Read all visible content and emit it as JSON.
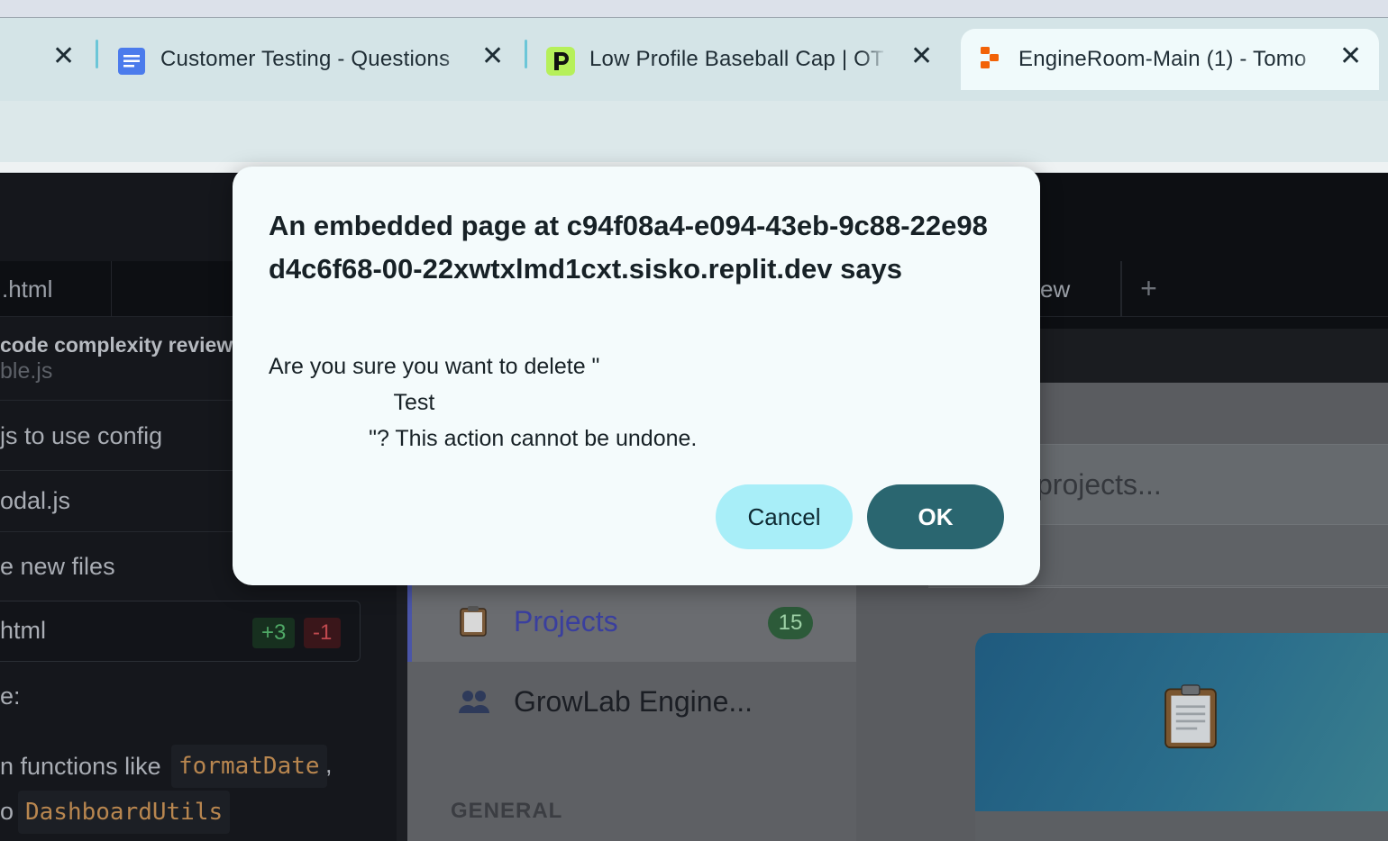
{
  "browser": {
    "tabs": [
      {
        "title": "Customer Testing - Questions",
        "icon": "google-docs-icon",
        "active": false
      },
      {
        "title": "Low Profile Baseball Cap | OT",
        "icon": "p-logo-icon",
        "active": false
      },
      {
        "title": "EngineRoom-Main (1) - Tomo",
        "icon": "replit-icon",
        "active": true
      }
    ],
    "close_glyph": "✕"
  },
  "editor": {
    "tabs": [
      ".html",
      "ew"
    ],
    "add_tab_glyph": "+"
  },
  "chat": {
    "lines": [
      "code complexity review",
      "ble.js",
      "js to use config",
      "odal.js",
      "e new files",
      "html",
      "e:",
      "n functions like",
      "o"
    ],
    "diff_add": "+3",
    "diff_del": "-1",
    "code_spans": [
      "formatDate",
      "DashboardUtils"
    ],
    "trailing_comma": ","
  },
  "sidebar": {
    "items": [
      {
        "label": "Projects",
        "icon": "clipboard-icon",
        "count": "15"
      },
      {
        "label": "GrowLab Engine...",
        "icon": "people-icon"
      }
    ],
    "section": "GENERAL"
  },
  "main": {
    "search_placeholder": "projects..."
  },
  "dialog": {
    "title": "An embedded page at c94f08a4-e094-43eb-9c88-22e98d4c6f68-00-22xwtxlmd1cxt.sisko.replit.dev says",
    "message": "Are you sure you want to delete \"\n                    Test\n                \"? This action cannot be undone.",
    "cancel_label": "Cancel",
    "ok_label": "OK"
  },
  "colors": {
    "ok_button": "#2a6670",
    "cancel_button": "#a8eef8",
    "badge": "#2c5a39"
  }
}
